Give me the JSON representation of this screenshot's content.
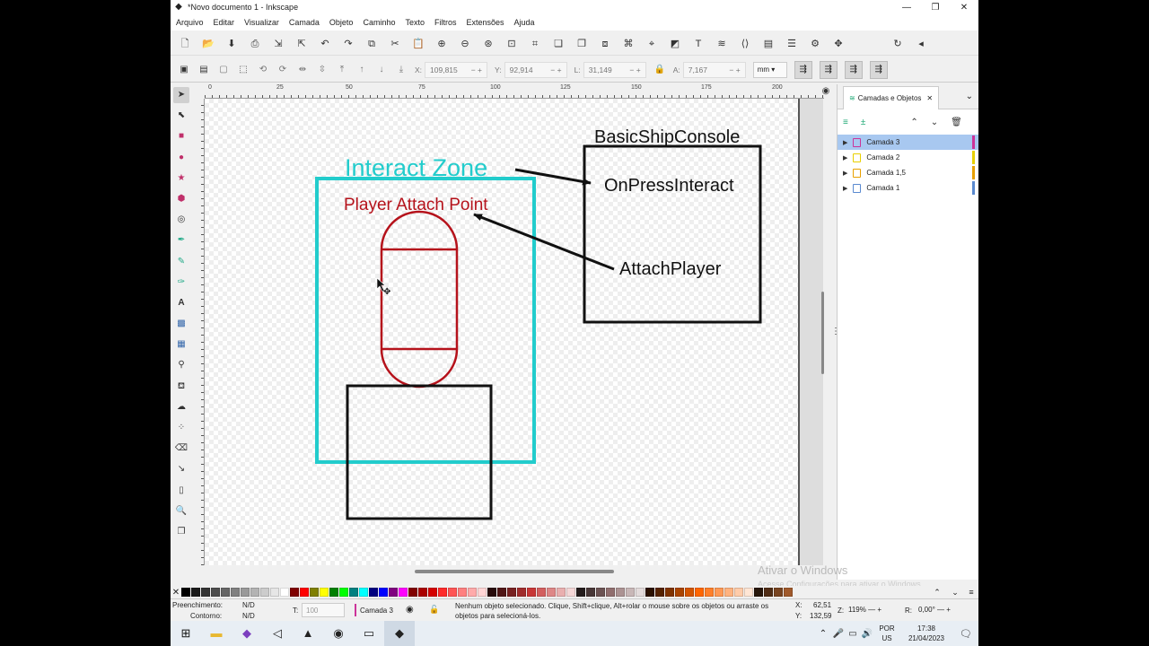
{
  "window": {
    "title": "*Novo documento 1 - Inkscape"
  },
  "menu": [
    "Arquivo",
    "Editar",
    "Visualizar",
    "Camada",
    "Objeto",
    "Caminho",
    "Texto",
    "Filtros",
    "Extensões",
    "Ajuda"
  ],
  "coords": {
    "x_label": "X:",
    "x_value": "109,815",
    "y_label": "Y:",
    "y_value": "92,914",
    "w_label": "L:",
    "w_value": "31,149",
    "h_label": "A:",
    "h_value": "7,167",
    "unit": "mm"
  },
  "ruler": {
    "ticks": [
      "0",
      "25",
      "50",
      "75",
      "100",
      "125",
      "150",
      "175",
      "200"
    ]
  },
  "drawing": {
    "interact_zone": "Interact Zone",
    "player_attach": "Player Attach Point",
    "ship_console": "BasicShipConsole",
    "on_press": "OnPressInteract",
    "attach_player": "AttachPlayer",
    "colors": {
      "cyan": "#22cccc",
      "red": "#b5121b",
      "black": "#111111"
    }
  },
  "panel": {
    "tab_label": "Camadas e Objetos",
    "layers": [
      {
        "name": "Camada 3",
        "color": "#cc3399"
      },
      {
        "name": "Camada 2",
        "color": "#e8d000"
      },
      {
        "name": "Camada 1,5",
        "color": "#e8a000"
      },
      {
        "name": "Camada 1",
        "color": "#5a8ad0"
      }
    ]
  },
  "watermark": {
    "line1": "Ativar o Windows",
    "line2": "Acesse Configurações para ativar o Windows."
  },
  "status": {
    "fill_label": "Preenchimento:",
    "fill_value": "N/D",
    "stroke_label": "Contorno:",
    "stroke_value": "N/D",
    "opacity_label": "T:",
    "opacity_value": "100",
    "layer": "Camada 3",
    "message": "Nenhum objeto selecionado. Clique, Shift+clique, Alt+rolar o mouse sobre os objetos ou arraste os objetos para selecioná-los.",
    "cx_label": "X:",
    "cx_value": "62,51",
    "cy_label": "Y:",
    "cy_value": "132,59",
    "zoom_label": "Z:",
    "zoom_value": "119%",
    "rot_label": "R:",
    "rot_value": "0,00°"
  },
  "taskbar": {
    "lang1": "POR",
    "lang2": "US",
    "time": "17:38",
    "date": "21/04/2023"
  },
  "palette": [
    "#000000",
    "#1a1a1a",
    "#333333",
    "#4d4d4d",
    "#666666",
    "#808080",
    "#999999",
    "#b3b3b3",
    "#cccccc",
    "#e6e6e6",
    "#ffffff",
    "#800000",
    "#ff0000",
    "#808000",
    "#ffff00",
    "#008000",
    "#00ff00",
    "#008080",
    "#00ffff",
    "#000080",
    "#0000ff",
    "#800080",
    "#ff00ff",
    "#800000",
    "#aa0000",
    "#d40000",
    "#ff2a2a",
    "#ff5555",
    "#ff8080",
    "#ffaaaa",
    "#ffd5d5",
    "#280b0b",
    "#501616",
    "#782121",
    "#a02c2c",
    "#c83737",
    "#d35f5f",
    "#de8787",
    "#e9afaf",
    "#f4d7d7",
    "#241c1c",
    "#483737",
    "#6c5353",
    "#916f6f",
    "#ac9393",
    "#c8b7b7",
    "#e3dbdb",
    "#2b1100",
    "#552200",
    "#803300",
    "#aa4400",
    "#d45500",
    "#ff6600",
    "#ff7f2a",
    "#ff9955",
    "#ffb380",
    "#ffccaa",
    "#ffe6d5",
    "#28170b",
    "#502d16",
    "#784421",
    "#a05a2c"
  ]
}
